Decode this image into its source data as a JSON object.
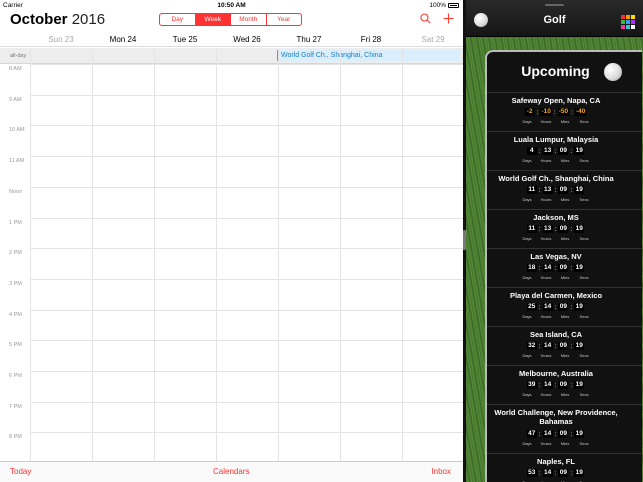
{
  "status": {
    "carrier": "Carrier",
    "time": "10:50 AM",
    "battery": "100%"
  },
  "calendar": {
    "month": "October",
    "year": "2016",
    "views": [
      "Day",
      "Week",
      "Month",
      "Year"
    ],
    "active_view": "Week",
    "days": [
      {
        "label": "Sun 23",
        "dim": true
      },
      {
        "label": "Mon 24",
        "dim": false
      },
      {
        "label": "Tue 25",
        "dim": false
      },
      {
        "label": "Wed 26",
        "dim": false
      },
      {
        "label": "Thu 27",
        "dim": false
      },
      {
        "label": "Fri 28",
        "dim": false
      },
      {
        "label": "Sat 29",
        "dim": true
      }
    ],
    "allday_label": "all-day",
    "allday_event": "World Golf Ch., Shanghai, China",
    "hours": [
      "8 AM",
      "9 AM",
      "10 AM",
      "11 AM",
      "Noon",
      "1 PM",
      "2 PM",
      "3 PM",
      "4 PM",
      "5 PM",
      "6 PM",
      "7 PM",
      "8 PM"
    ],
    "toolbar": {
      "today": "Today",
      "calendars": "Calendars",
      "inbox": "Inbox"
    },
    "icons": [
      "search-icon",
      "add-icon"
    ],
    "accent": "#ff3b30"
  },
  "golf": {
    "title": "Golf",
    "upcoming_title": "Upcoming",
    "units": [
      "Days",
      "Hours",
      "Mins",
      "Secs"
    ],
    "events": [
      {
        "name": "Safeway Open, Napa, CA",
        "countdown": [
          "-2",
          "-10",
          "-50",
          "-40"
        ],
        "negative": true
      },
      {
        "name": "Luala Lumpur, Malaysia",
        "countdown": [
          "4",
          "13",
          "09",
          "19"
        ]
      },
      {
        "name": "World Golf Ch., Shanghai, China",
        "countdown": [
          "11",
          "13",
          "09",
          "19"
        ]
      },
      {
        "name": "Jackson, MS",
        "countdown": [
          "11",
          "13",
          "09",
          "19"
        ]
      },
      {
        "name": "Las Vegas, NV",
        "countdown": [
          "18",
          "14",
          "09",
          "19"
        ]
      },
      {
        "name": "Playa del Carmen, Mexico",
        "countdown": [
          "25",
          "14",
          "09",
          "19"
        ]
      },
      {
        "name": "Sea Island, CA",
        "countdown": [
          "32",
          "14",
          "09",
          "19"
        ]
      },
      {
        "name": "Melbourne, Australia",
        "countdown": [
          "39",
          "14",
          "09",
          "19"
        ]
      },
      {
        "name": "World Challenge, New Providence, Bahamas",
        "countdown": [
          "47",
          "14",
          "09",
          "19"
        ],
        "tall": true
      },
      {
        "name": "Naples, FL",
        "countdown": [
          "53",
          "14",
          "09",
          "19"
        ]
      }
    ],
    "grid_icon_colors": [
      "#e33",
      "#f90",
      "#fd0",
      "#3b3",
      "#39f",
      "#a3f",
      "#f39",
      "#3cc",
      "#fff"
    ]
  }
}
